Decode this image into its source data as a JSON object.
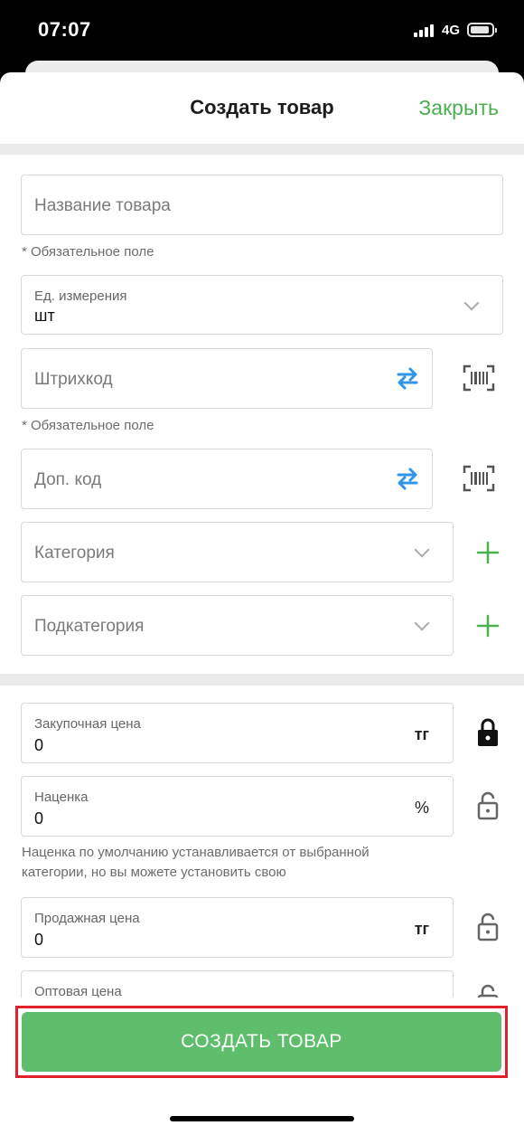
{
  "status_bar": {
    "time": "07:07",
    "network": "4G"
  },
  "header": {
    "title": "Создать товар",
    "close_label": "Закрыть"
  },
  "form": {
    "name_placeholder": "Название товара",
    "required_hint": "* Обязательное поле",
    "unit_label": "Ед. измерения",
    "unit_value": "шт",
    "barcode_placeholder": "Штрихкод",
    "extra_code_placeholder": "Доп. код",
    "category_placeholder": "Категория",
    "subcategory_placeholder": "Подкатегория"
  },
  "pricing": {
    "purchase_label": "Закупочная цена",
    "purchase_value": "0",
    "currency": "тг",
    "markup_label": "Наценка",
    "markup_value": "0",
    "percent": "%",
    "markup_note": "Наценка по умолчанию устанавливается от выбранной категории, но вы можете установить свою",
    "sale_label": "Продажная цена",
    "sale_value": "0",
    "wholesale_label": "Оптовая цена"
  },
  "actions": {
    "create_label": "СОЗДАТЬ ТОВАР"
  },
  "colors": {
    "accent_green": "#4caf50",
    "button_green": "#5fbe6b",
    "highlight_red": "#e0202a",
    "swap_blue": "#2f95e8"
  }
}
